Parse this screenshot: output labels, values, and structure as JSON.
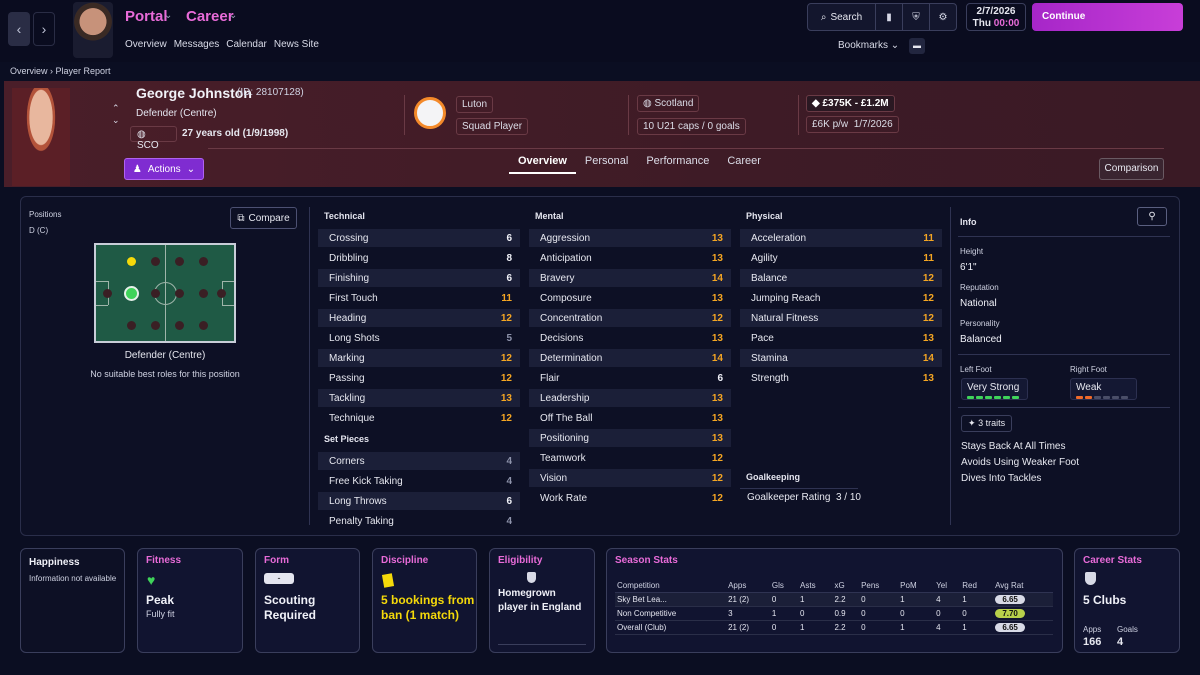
{
  "topbar": {
    "portal": "Portal",
    "career": "Career",
    "subnav": [
      "Overview",
      "Messages",
      "Calendar",
      "News Site"
    ],
    "search": "Search",
    "date": "2/7/2026",
    "day": "Thu",
    "time": "00:00",
    "continue": "Continue",
    "bookmarks": "Bookmarks"
  },
  "breadcrumb": {
    "root": "Overview",
    "current": "Player Report"
  },
  "player": {
    "name": "George Johnston",
    "id": "(ID: 28107128)",
    "position": "Defender (Centre)",
    "nation_code": "SCO",
    "age": "27 years old (1/9/1998)",
    "club": "Luton",
    "squad_status": "Squad Player",
    "nation": "Scotland",
    "caps": "10 U21 caps / 0 goals",
    "value": "£375K - £1.2M",
    "wage": "£6K p/w",
    "contract": "1/7/2026",
    "actions": "Actions",
    "accent_color": "#7f2cd1"
  },
  "tabs": [
    "Overview",
    "Personal",
    "Performance",
    "Career"
  ],
  "comparison": "Comparison",
  "positions": {
    "label": "Positions",
    "value": "D (C)",
    "compare": "Compare",
    "caption": "Defender (Centre)",
    "note": "No suitable best roles for this position"
  },
  "technical": {
    "title": "Technical",
    "items": [
      [
        "Crossing",
        "6"
      ],
      [
        "Dribbling",
        "8"
      ],
      [
        "Finishing",
        "6"
      ],
      [
        "First Touch",
        "11"
      ],
      [
        "Heading",
        "12"
      ],
      [
        "Long Shots",
        "5"
      ],
      [
        "Marking",
        "12"
      ],
      [
        "Passing",
        "12"
      ],
      [
        "Tackling",
        "13"
      ],
      [
        "Technique",
        "12"
      ]
    ]
  },
  "set_pieces": {
    "title": "Set Pieces",
    "items": [
      [
        "Corners",
        "4"
      ],
      [
        "Free Kick Taking",
        "4"
      ],
      [
        "Long Throws",
        "6"
      ],
      [
        "Penalty Taking",
        "4"
      ]
    ]
  },
  "mental": {
    "title": "Mental",
    "items": [
      [
        "Aggression",
        "13"
      ],
      [
        "Anticipation",
        "13"
      ],
      [
        "Bravery",
        "14"
      ],
      [
        "Composure",
        "13"
      ],
      [
        "Concentration",
        "12"
      ],
      [
        "Decisions",
        "13"
      ],
      [
        "Determination",
        "14"
      ],
      [
        "Flair",
        "6"
      ],
      [
        "Leadership",
        "13"
      ],
      [
        "Off The Ball",
        "13"
      ],
      [
        "Positioning",
        "13"
      ],
      [
        "Teamwork",
        "12"
      ],
      [
        "Vision",
        "12"
      ],
      [
        "Work Rate",
        "12"
      ]
    ]
  },
  "physical": {
    "title": "Physical",
    "items": [
      [
        "Acceleration",
        "11"
      ],
      [
        "Agility",
        "11"
      ],
      [
        "Balance",
        "12"
      ],
      [
        "Jumping Reach",
        "12"
      ],
      [
        "Natural Fitness",
        "12"
      ],
      [
        "Pace",
        "13"
      ],
      [
        "Stamina",
        "14"
      ],
      [
        "Strength",
        "13"
      ]
    ]
  },
  "goalkeeping": {
    "title": "Goalkeeping",
    "label": "Goalkeeper Rating",
    "value": "3 / 10"
  },
  "info": {
    "title": "Info",
    "height_label": "Height",
    "height": "6'1\"",
    "reputation_label": "Reputation",
    "reputation": "National",
    "personality_label": "Personality",
    "personality": "Balanced",
    "left_foot_label": "Left Foot",
    "left_foot": "Very Strong",
    "right_foot_label": "Right Foot",
    "right_foot": "Weak",
    "traits_count": "3 traits",
    "traits": [
      "Stays Back At All Times",
      "Avoids Using Weaker Foot",
      "Dives Into Tackles"
    ]
  },
  "cards": {
    "happiness": {
      "title": "Happiness",
      "text": "Information not available"
    },
    "fitness": {
      "title": "Fitness",
      "value": "Peak",
      "sub": "Fully fit"
    },
    "form": {
      "title": "Form",
      "chip": "-",
      "value": "Scouting Required"
    },
    "discipline": {
      "title": "Discipline",
      "value": "5 bookings from ban (1 match)"
    },
    "eligibility": {
      "title": "Eligibility",
      "value": "Homegrown player in England"
    },
    "career": {
      "title": "Career Stats",
      "value": "5 Clubs",
      "apps_label": "Apps",
      "apps": "166",
      "goals_label": "Goals",
      "goals": "4"
    }
  },
  "season": {
    "title": "Season Stats",
    "headers": [
      "Competition",
      "Apps",
      "Gls",
      "Asts",
      "xG",
      "Pens",
      "PoM",
      "Yel",
      "Red",
      "Avg Rat"
    ],
    "rows": [
      [
        "Sky Bet Lea...",
        "21 (2)",
        "0",
        "1",
        "2.2",
        "0",
        "1",
        "4",
        "1",
        "6.65"
      ],
      [
        "Non Competitive",
        "3",
        "1",
        "0",
        "0.9",
        "0",
        "0",
        "0",
        "0",
        "7.70"
      ],
      [
        "Overall (Club)",
        "21 (2)",
        "0",
        "1",
        "2.2",
        "0",
        "1",
        "4",
        "1",
        "6.65"
      ]
    ]
  }
}
